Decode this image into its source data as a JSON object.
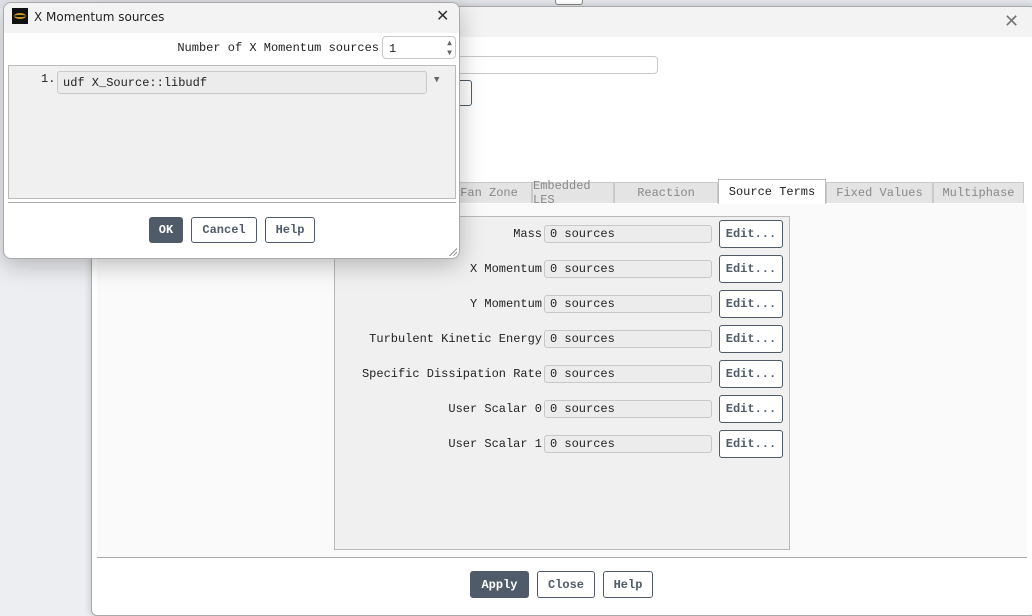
{
  "main_dialog": {
    "tabs": [
      {
        "label": "Fan Zone",
        "active": false
      },
      {
        "label": "Embedded LES",
        "active": false
      },
      {
        "label": "Reaction",
        "active": false
      },
      {
        "label": "Source Terms",
        "active": true
      },
      {
        "label": "Fixed Values",
        "active": false
      },
      {
        "label": "Multiphase",
        "active": false
      }
    ],
    "source_rows": [
      {
        "label": "Mass",
        "value": "0 sources",
        "button": "Edit..."
      },
      {
        "label": "X Momentum",
        "value": "0 sources",
        "button": "Edit..."
      },
      {
        "label": "Y Momentum",
        "value": "0 sources",
        "button": "Edit..."
      },
      {
        "label": "Turbulent Kinetic Energy",
        "value": "0 sources",
        "button": "Edit..."
      },
      {
        "label": "Specific Dissipation Rate",
        "value": "0 sources",
        "button": "Edit..."
      },
      {
        "label": "User Scalar 0",
        "value": "0 sources",
        "button": "Edit..."
      },
      {
        "label": "User Scalar 1",
        "value": "0 sources",
        "button": "Edit..."
      }
    ],
    "apply": "Apply",
    "close": "Close",
    "help": "Help"
  },
  "popup": {
    "title": "X Momentum sources",
    "count_label": "Number of X Momentum sources",
    "count_value": "1",
    "items": [
      {
        "index": "1.",
        "value": "udf X_Source::libudf"
      }
    ],
    "ok": "OK",
    "cancel": "Cancel",
    "help": "Help"
  },
  "colors": {
    "primary_button": "#4f5b69"
  }
}
